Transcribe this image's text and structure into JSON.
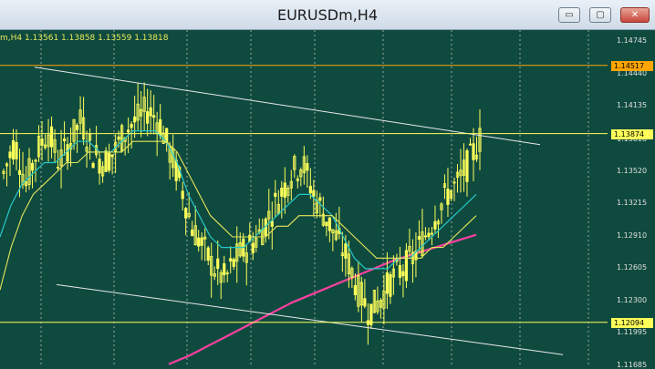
{
  "window": {
    "title": "EURUSDm,H4",
    "buttons": {
      "minimize": "▭",
      "maximize": "▢",
      "close": "✕"
    }
  },
  "chart": {
    "info_line": "m,H4  1.13561 1.13858 1.13559 1.13818",
    "price_scale": [
      "1.14745",
      "1.14440",
      "1.14135",
      "1.13818",
      "1.13520",
      "1.13215",
      "1.12910",
      "1.12605",
      "1.12300",
      "1.11995",
      "1.11685"
    ],
    "horizontal_levels": [
      {
        "label": "1.14517",
        "color": "#ffa500"
      },
      {
        "label": "1.13874",
        "color": "#ffff5a"
      },
      {
        "label": "1.12094",
        "color": "#ffff5a"
      }
    ],
    "colors": {
      "background": "#0f4a3f",
      "candles": "#ffff5a",
      "ma_fast": "#25c9c9",
      "ma_slow": "#e6e65a",
      "ma_long": "#ff40a0",
      "channel": "#e8e8e8",
      "grid": "#9aa89a"
    }
  },
  "chart_data": {
    "type": "line",
    "symbol": "EURUSDm",
    "timeframe": "H4",
    "ylim": [
      1.1168,
      1.1485
    ],
    "ohlc_last": {
      "open": 1.13561,
      "high": 1.13858,
      "low": 1.13559,
      "close": 1.13818
    },
    "series": [
      {
        "values": [
          1.135,
          1.138,
          1.134,
          1.137,
          1.139,
          1.136,
          1.138,
          1.14,
          1.137,
          1.136,
          1.137,
          1.139,
          1.14,
          1.141,
          1.14,
          1.137,
          1.134,
          1.13,
          1.128,
          1.126,
          1.125,
          1.127,
          1.128,
          1.129,
          1.131,
          1.133,
          1.135,
          1.136,
          1.133,
          1.131,
          1.129,
          1.127,
          1.124,
          1.122,
          1.123,
          1.125,
          1.126,
          1.127,
          1.129,
          1.131,
          1.133,
          1.134,
          1.136,
          1.1382
        ]
      },
      {
        "values": [
          1.129,
          1.132,
          1.134,
          1.135,
          1.136,
          1.136,
          1.137,
          1.138,
          1.138,
          1.137,
          1.137,
          1.138,
          1.139,
          1.139,
          1.139,
          1.138,
          1.136,
          1.133,
          1.131,
          1.129,
          1.128,
          1.128,
          1.128,
          1.129,
          1.13,
          1.131,
          1.132,
          1.133,
          1.133,
          1.132,
          1.131,
          1.129,
          1.127,
          1.126,
          1.126,
          1.126,
          1.127,
          1.127,
          1.128,
          1.129,
          1.13,
          1.131,
          1.132,
          1.133
        ]
      },
      {
        "values": [
          1.124,
          1.128,
          1.131,
          1.133,
          1.134,
          1.135,
          1.136,
          1.136,
          1.137,
          1.137,
          1.137,
          1.137,
          1.138,
          1.138,
          1.138,
          1.138,
          1.137,
          1.135,
          1.133,
          1.131,
          1.13,
          1.129,
          1.129,
          1.129,
          1.129,
          1.13,
          1.13,
          1.131,
          1.131,
          1.131,
          1.131,
          1.13,
          1.129,
          1.128,
          1.127,
          1.127,
          1.127,
          1.127,
          1.127,
          1.128,
          1.128,
          1.129,
          1.13,
          1.131
        ]
      },
      {
        "values": [
          1.117,
          1.1178,
          1.1188,
          1.1198,
          1.1208,
          1.1218,
          1.1228,
          1.1236,
          1.1244,
          1.1252,
          1.126,
          1.1268,
          1.1274,
          1.128,
          1.1286,
          1.1292
        ]
      }
    ],
    "levels": [
      1.14517,
      1.13874,
      1.12094
    ]
  }
}
